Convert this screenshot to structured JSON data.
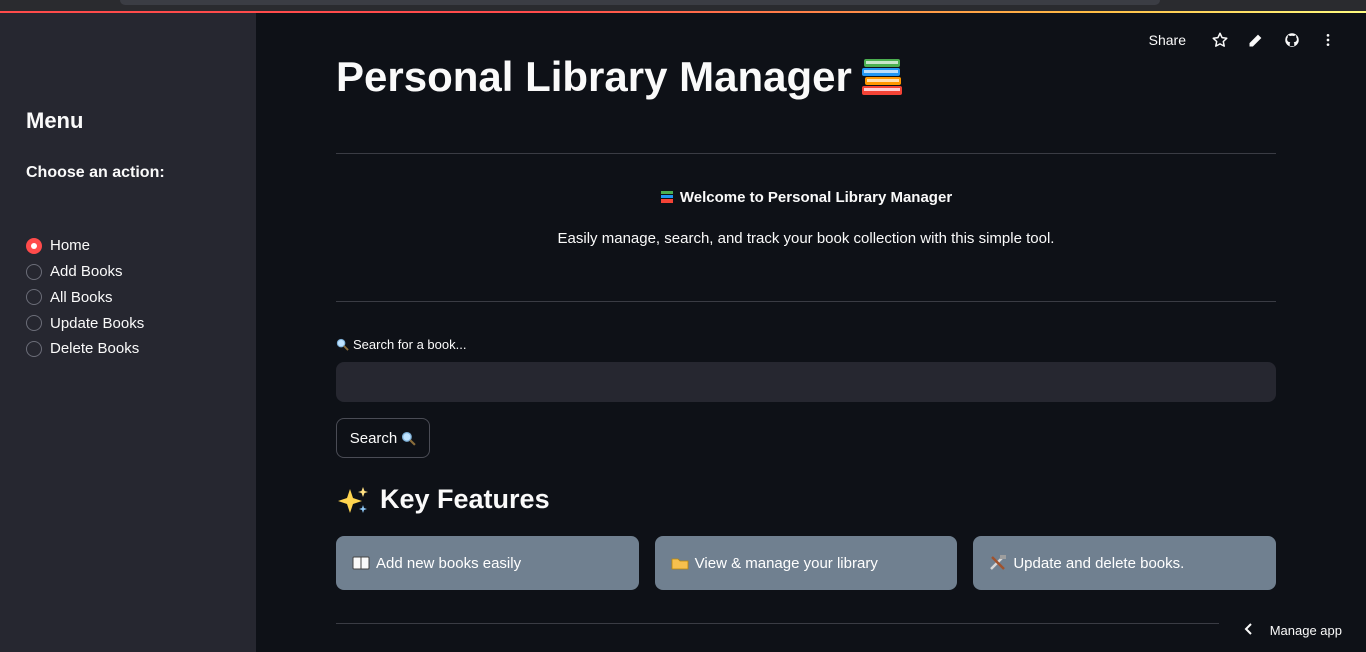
{
  "sidebar": {
    "title": "Menu",
    "label": "Choose an action:",
    "options": [
      {
        "label": "Home",
        "selected": true
      },
      {
        "label": "Add Books",
        "selected": false
      },
      {
        "label": "All Books",
        "selected": false
      },
      {
        "label": "Update Books",
        "selected": false
      },
      {
        "label": "Delete Books",
        "selected": false
      }
    ]
  },
  "toolbar": {
    "share_label": "Share",
    "icons": [
      "star-icon",
      "pencil-icon",
      "github-icon",
      "more-icon"
    ]
  },
  "main": {
    "title": "Personal Library Manager",
    "title_icon": "books-icon",
    "welcome": "Welcome to Personal Library Manager",
    "subtitle": "Easily manage, search, and track your book collection with this simple tool.",
    "search": {
      "label": "Search for a book...",
      "value": "",
      "button_label": "Search"
    },
    "features_heading": "Key Features",
    "features": [
      {
        "icon": "open-book-icon",
        "label": "Add new books easily"
      },
      {
        "icon": "folder-icon",
        "label": "View & manage your library"
      },
      {
        "icon": "tools-icon",
        "label": "Update and delete books."
      }
    ]
  },
  "footer": {
    "manage_label": "Manage app"
  },
  "colors": {
    "accent": "#ff4b4b",
    "background": "#0e1117",
    "sidebar": "#262730",
    "card": "#708090"
  }
}
